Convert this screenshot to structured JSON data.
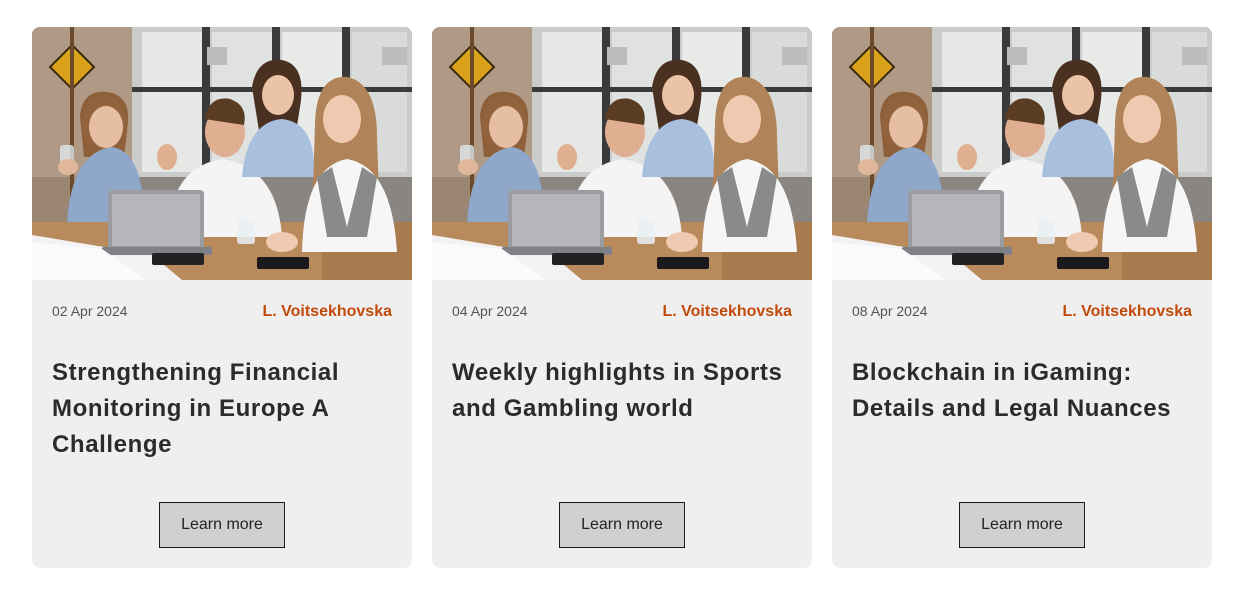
{
  "cards": [
    {
      "date": "02 Apr 2024",
      "author": "L. Voitsekhovska",
      "title": "Strengthening Financial Monitoring in Europe A Challenge",
      "button": "Learn more"
    },
    {
      "date": "04 Apr 2024",
      "author": "L. Voitsekhovska",
      "title": "Weekly highlights in Sports and Gambling world",
      "button": "Learn more"
    },
    {
      "date": "08 Apr 2024",
      "author": "L. Voitsekhovska",
      "title": "Blockchain in iGaming: Details and Legal Nuances",
      "button": "Learn more"
    }
  ],
  "colors": {
    "card_bg": "#efefef",
    "author": "#c24a0a",
    "title": "#2b2b2b",
    "button_bg": "#d0d0d0"
  }
}
